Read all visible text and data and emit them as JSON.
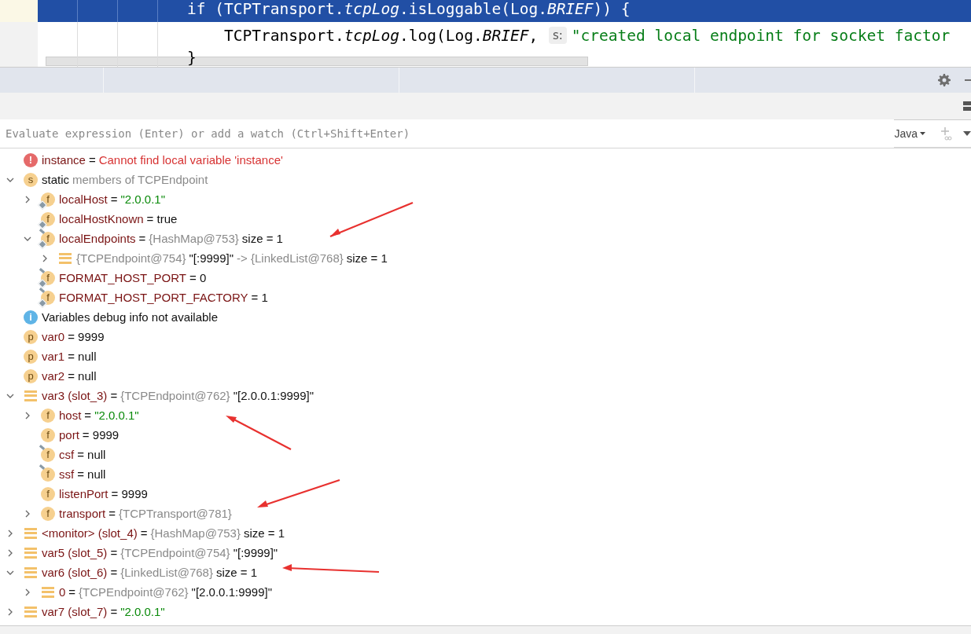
{
  "editor": {
    "lines": [
      {
        "highlighted": true,
        "kind": "statement",
        "code": "if (TCPTransport.*tcpLog*.isLoggable(Log.*BRIEF*)) {"
      },
      {
        "highlighted": false,
        "kind": "nested",
        "code": "TCPTransport.*tcpLog*.log(Log.*BRIEF*, ",
        "hint": "s:",
        "string": "\"created local endpoint for socket factor"
      },
      {
        "highlighted": false,
        "kind": "statement",
        "code": "}"
      }
    ]
  },
  "evaluate": {
    "placeholder": "Evaluate expression (Enter) or add a watch (Ctrl+Shift+Enter)",
    "language": "Java"
  },
  "variables": [
    {
      "kind": "error",
      "glyph": "!",
      "parts": [
        {
          "kind": "name",
          "text": "instance"
        },
        {
          "kind": "plain",
          "text": "="
        },
        {
          "kind": "error",
          "text": "Cannot find local variable 'instance'"
        }
      ]
    },
    {
      "kind": "static",
      "glyph": "s",
      "expanded": true,
      "parts": [
        {
          "kind": "plain",
          "text": "static"
        },
        {
          "kind": "type",
          "text": "members of TCPEndpoint"
        }
      ],
      "children": [
        {
          "kind": "field-static",
          "glyph": "f",
          "expanded": false,
          "parts": [
            {
              "kind": "name",
              "text": "localHost"
            },
            {
              "kind": "plain",
              "text": "="
            },
            {
              "kind": "string",
              "text": "\"2.0.0.1\""
            }
          ]
        },
        {
          "kind": "field-static",
          "glyph": "f",
          "parts": [
            {
              "kind": "name",
              "text": "localHostKnown"
            },
            {
              "kind": "plain",
              "text": "= true"
            }
          ]
        },
        {
          "kind": "field-static-final",
          "glyph": "f",
          "expanded": true,
          "parts": [
            {
              "kind": "name",
              "text": "localEndpoints"
            },
            {
              "kind": "plain",
              "text": "="
            },
            {
              "kind": "type",
              "text": "{HashMap@753}"
            },
            {
              "kind": "plain",
              "text": "size = 1"
            }
          ],
          "children": [
            {
              "kind": "object",
              "expanded": false,
              "parts": [
                {
                  "kind": "type",
                  "text": "{TCPEndpoint@754}"
                },
                {
                  "kind": "plain",
                  "text": "\"[:9999]\""
                },
                {
                  "kind": "type",
                  "text": "-> {LinkedList@768}"
                },
                {
                  "kind": "plain",
                  "text": "size = 1"
                }
              ]
            }
          ]
        },
        {
          "kind": "field-static-final",
          "glyph": "f",
          "parts": [
            {
              "kind": "name",
              "text": "FORMAT_HOST_PORT"
            },
            {
              "kind": "plain",
              "text": "= 0"
            }
          ]
        },
        {
          "kind": "field-static-final",
          "glyph": "f",
          "parts": [
            {
              "kind": "name",
              "text": "FORMAT_HOST_PORT_FACTORY"
            },
            {
              "kind": "plain",
              "text": "= 1"
            }
          ]
        }
      ]
    },
    {
      "kind": "info",
      "glyph": "i",
      "parts": [
        {
          "kind": "plain",
          "text": "Variables debug info not available"
        }
      ]
    },
    {
      "kind": "param",
      "glyph": "p",
      "parts": [
        {
          "kind": "name",
          "text": "var0"
        },
        {
          "kind": "plain",
          "text": "= 9999"
        }
      ]
    },
    {
      "kind": "param",
      "glyph": "p",
      "parts": [
        {
          "kind": "name",
          "text": "var1"
        },
        {
          "kind": "plain",
          "text": "= null"
        }
      ]
    },
    {
      "kind": "param",
      "glyph": "p",
      "parts": [
        {
          "kind": "name",
          "text": "var2"
        },
        {
          "kind": "plain",
          "text": "= null"
        }
      ]
    },
    {
      "kind": "object",
      "expanded": true,
      "parts": [
        {
          "kind": "name",
          "text": "var3 (slot_3)"
        },
        {
          "kind": "plain",
          "text": "="
        },
        {
          "kind": "type",
          "text": "{TCPEndpoint@762}"
        },
        {
          "kind": "plain",
          "text": "\"[2.0.0.1:9999]\""
        }
      ],
      "children": [
        {
          "kind": "field",
          "glyph": "f",
          "expanded": false,
          "parts": [
            {
              "kind": "name",
              "text": "host"
            },
            {
              "kind": "plain",
              "text": "="
            },
            {
              "kind": "string",
              "text": "\"2.0.0.1\""
            }
          ]
        },
        {
          "kind": "field",
          "glyph": "f",
          "parts": [
            {
              "kind": "name",
              "text": "port"
            },
            {
              "kind": "plain",
              "text": "= 9999"
            }
          ]
        },
        {
          "kind": "field-final",
          "glyph": "f",
          "parts": [
            {
              "kind": "name",
              "text": "csf"
            },
            {
              "kind": "plain",
              "text": "= null"
            }
          ]
        },
        {
          "kind": "field-final",
          "glyph": "f",
          "parts": [
            {
              "kind": "name",
              "text": "ssf"
            },
            {
              "kind": "plain",
              "text": "= null"
            }
          ]
        },
        {
          "kind": "field",
          "glyph": "f",
          "parts": [
            {
              "kind": "name",
              "text": "listenPort"
            },
            {
              "kind": "plain",
              "text": "= 9999"
            }
          ]
        },
        {
          "kind": "field",
          "glyph": "f",
          "expanded": false,
          "parts": [
            {
              "kind": "name",
              "text": "transport"
            },
            {
              "kind": "plain",
              "text": "="
            },
            {
              "kind": "type",
              "text": "{TCPTransport@781}"
            }
          ]
        }
      ]
    },
    {
      "kind": "object",
      "expanded": false,
      "parts": [
        {
          "kind": "name",
          "text": "<monitor> (slot_4)"
        },
        {
          "kind": "plain",
          "text": "="
        },
        {
          "kind": "type",
          "text": "{HashMap@753}"
        },
        {
          "kind": "plain",
          "text": "size = 1"
        }
      ]
    },
    {
      "kind": "object",
      "expanded": false,
      "parts": [
        {
          "kind": "name",
          "text": "var5 (slot_5)"
        },
        {
          "kind": "plain",
          "text": "="
        },
        {
          "kind": "type",
          "text": "{TCPEndpoint@754}"
        },
        {
          "kind": "plain",
          "text": "\"[:9999]\""
        }
      ]
    },
    {
      "kind": "object",
      "expanded": true,
      "parts": [
        {
          "kind": "name",
          "text": "var6 (slot_6)"
        },
        {
          "kind": "plain",
          "text": "="
        },
        {
          "kind": "type",
          "text": "{LinkedList@768}"
        },
        {
          "kind": "plain",
          "text": "size = 1"
        }
      ],
      "children": [
        {
          "kind": "object",
          "expanded": false,
          "parts": [
            {
              "kind": "name",
              "text": "0"
            },
            {
              "kind": "plain",
              "text": "="
            },
            {
              "kind": "type",
              "text": "{TCPEndpoint@762}"
            },
            {
              "kind": "plain",
              "text": "\"[2.0.0.1:9999]\""
            }
          ]
        }
      ]
    },
    {
      "kind": "object",
      "expanded": false,
      "parts": [
        {
          "kind": "name",
          "text": "var7 (slot_7)"
        },
        {
          "kind": "plain",
          "text": "="
        },
        {
          "kind": "string",
          "text": "\"2.0.0.1\""
        }
      ]
    }
  ]
}
